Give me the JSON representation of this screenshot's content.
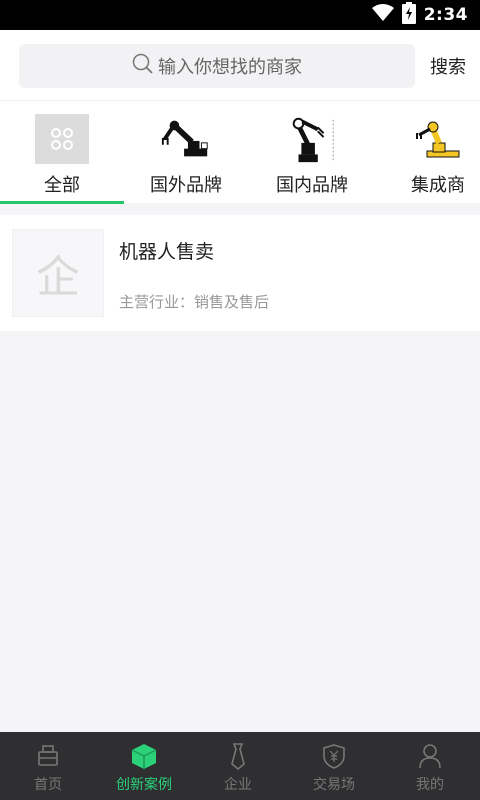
{
  "status_bar": {
    "time": "2:34"
  },
  "search": {
    "placeholder": "输入你想找的商家",
    "button": "搜索"
  },
  "categories": [
    {
      "label": "全部",
      "active": true
    },
    {
      "label": "国外品牌",
      "active": false
    },
    {
      "label": "国内品牌",
      "active": false
    },
    {
      "label": "集成商",
      "active": false
    }
  ],
  "merchants": [
    {
      "thumb_char": "企",
      "name": "机器人售卖",
      "industry": "主营行业：销售及售后"
    }
  ],
  "tabs": [
    {
      "label": "首页",
      "active": false
    },
    {
      "label": "创新案例",
      "active": true
    },
    {
      "label": "企业",
      "active": false
    },
    {
      "label": "交易场",
      "active": false
    },
    {
      "label": "我的",
      "active": false
    }
  ],
  "colors": {
    "accent": "#26c66b",
    "tabbar_bg": "#2f2f31",
    "inactive_tab": "#777777"
  }
}
